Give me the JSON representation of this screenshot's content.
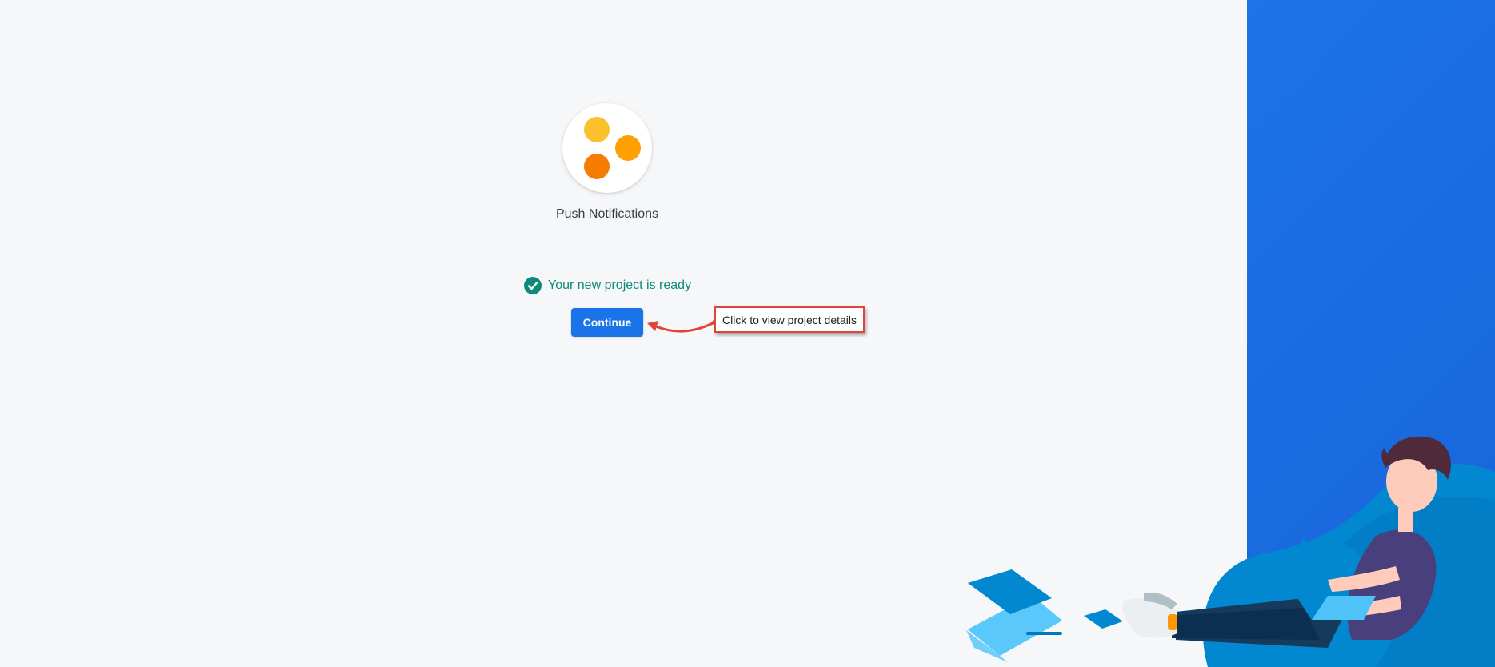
{
  "project": {
    "name": "Push Notifications",
    "icon": "three-dots-logo-icon",
    "icon_colors": [
      "#fbc02d",
      "#ffa000",
      "#f57c00"
    ]
  },
  "status": {
    "text": "Your new project is ready",
    "icon": "check-circle-icon",
    "color": "#0e8a7b"
  },
  "actions": {
    "continue_label": "Continue"
  },
  "callout": {
    "text": "Click to view project details",
    "border_color": "#e0443a"
  },
  "theme": {
    "accent": "#1a73e8",
    "panel_blue": "#1d73e8",
    "background": "#f6f7f9"
  }
}
